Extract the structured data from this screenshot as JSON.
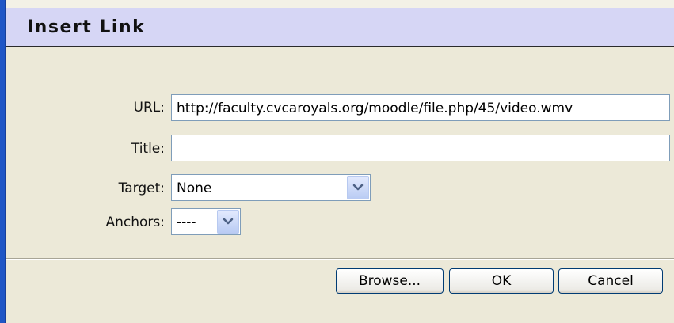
{
  "dialog": {
    "title": "Insert Link"
  },
  "form": {
    "url_label": "URL:",
    "url_value": "http://faculty.cvcaroyals.org/moodle/file.php/45/video.wmv",
    "title_label": "Title:",
    "title_value": "",
    "target_label": "Target:",
    "target_selected": "None",
    "anchors_label": "Anchors:",
    "anchors_selected": "----"
  },
  "buttons": {
    "browse_label": "Browse...",
    "ok_label": "OK",
    "cancel_label": "Cancel"
  },
  "icons": {
    "dropdown_arrow": "chevron-down-icon"
  },
  "colors": {
    "header_bg": "#d6d6f5",
    "window_bg": "#ece9d8",
    "frame_border": "#1f56c6",
    "input_border": "#7f9db9",
    "button_border": "#003c74"
  }
}
